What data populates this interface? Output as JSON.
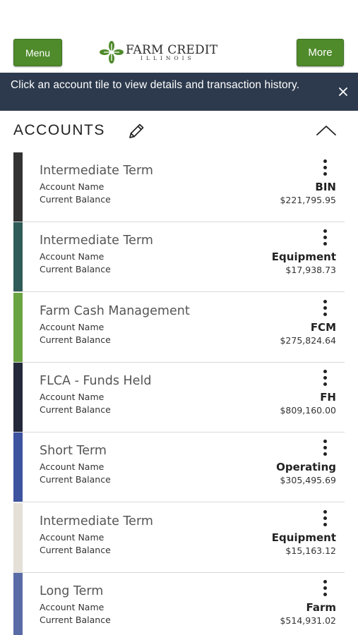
{
  "header": {
    "menu_label": "Menu",
    "more_label": "More",
    "logo": {
      "title": "FARM CREDIT",
      "subtitle": "ILLINOIS",
      "brand_color": "#4f8a2b"
    }
  },
  "banner": {
    "message": "Click an account tile to view details and transaction history.",
    "close_icon": "close-icon"
  },
  "accounts_section": {
    "title": "ACCOUNTS",
    "edit_icon": "pencil-icon",
    "collapse_icon": "chevron-up-icon"
  },
  "labels": {
    "account_name": "Account Name",
    "current_balance": "Current Balance"
  },
  "accounts": [
    {
      "type": "Intermediate Term",
      "name": "BIN",
      "balance": "$221,795.95",
      "color": "#333333"
    },
    {
      "type": "Intermediate Term",
      "name": "Equipment",
      "balance": "$17,938.73",
      "color": "#2f5b58"
    },
    {
      "type": "Farm Cash Management",
      "name": "FCM",
      "balance": "$275,824.64",
      "color": "#6aa341"
    },
    {
      "type": "FLCA - Funds Held",
      "name": "FH",
      "balance": "$809,160.00",
      "color": "#23283a"
    },
    {
      "type": "Short Term",
      "name": "Operating",
      "balance": "$305,495.69",
      "color": "#3d53a0"
    },
    {
      "type": "Intermediate Term",
      "name": "Equipment",
      "balance": "$15,163.12",
      "color": "#e4e0d8"
    },
    {
      "type": "Long Term",
      "name": "Farm",
      "balance": "$514,931.02",
      "color": "#5a6ca6"
    }
  ]
}
